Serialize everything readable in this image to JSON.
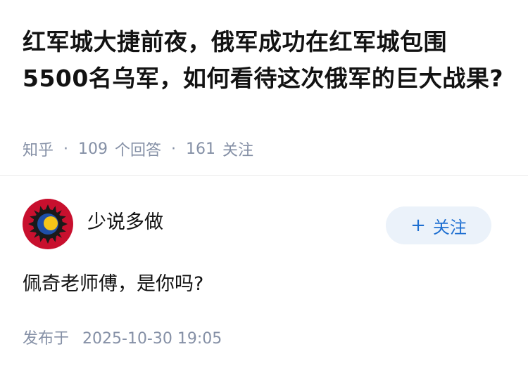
{
  "question": {
    "title": "红军城大捷前夜，俄军成功在红军城包围5500名乌军，如何看待这次俄军的巨大战果?",
    "site": "知乎",
    "answer_count": "109",
    "answer_count_label": "个回答",
    "follow_count": "161",
    "follow_count_label": "关注",
    "separator": "·"
  },
  "answer": {
    "author": {
      "name": "少说多做",
      "avatar_icon": "sun-moon-emblem-icon"
    },
    "follow_button": {
      "plus": "+",
      "label": "关注"
    },
    "content": "佩奇老师傅，是你吗?",
    "published_label": "发布于",
    "published_time": "2025-10-30 19:05"
  },
  "colors": {
    "title": "#121212",
    "meta": "#8590a6",
    "follow_bg": "#ebf2fa",
    "follow_text": "#1e6fd1",
    "avatar_ring": "#c8102e",
    "avatar_inner": "#1a1a1a",
    "avatar_moon": "#1f4fa8",
    "avatar_sun": "#f5c518"
  }
}
